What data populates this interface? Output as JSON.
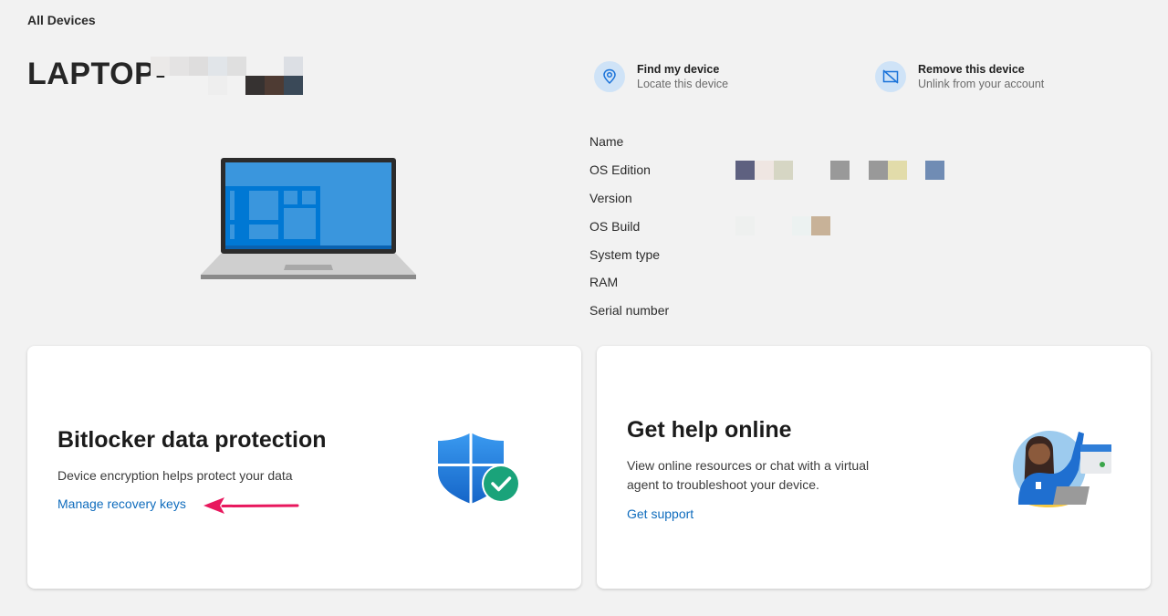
{
  "breadcrumb": "All Devices",
  "device": {
    "name_prefix": "LAPTOP-",
    "name_redacted": true
  },
  "actions": [
    {
      "icon": "location-pin-icon",
      "title": "Find my device",
      "subtitle": "Locate this device"
    },
    {
      "icon": "remove-device-icon",
      "title": "Remove this device",
      "subtitle": "Unlink from your account"
    }
  ],
  "specs": [
    {
      "label": "Name",
      "value_redacted": true
    },
    {
      "label": "OS Edition",
      "value_redacted": true
    },
    {
      "label": "Version",
      "value_redacted": true
    },
    {
      "label": "OS Build",
      "value_redacted": true
    },
    {
      "label": "System type",
      "value_redacted": true
    },
    {
      "label": "RAM",
      "value_redacted": true
    },
    {
      "label": "Serial number",
      "value_redacted": true
    }
  ],
  "cards": {
    "bitlocker": {
      "title": "Bitlocker data protection",
      "description": "Device encryption helps protect your data",
      "link": "Manage recovery keys",
      "icon": "shield-check-icon"
    },
    "help": {
      "title": "Get help online",
      "description_line1": "View online resources or chat with a virtual",
      "description_line2": "agent to troubleshoot your device.",
      "link": "Get support",
      "icon": "support-agent-illustration"
    }
  },
  "colors": {
    "accent": "#0f6cbd",
    "annotation_arrow": "#e8175d",
    "background": "#f2f2f2",
    "icon_circle": "#cfe3f7"
  }
}
